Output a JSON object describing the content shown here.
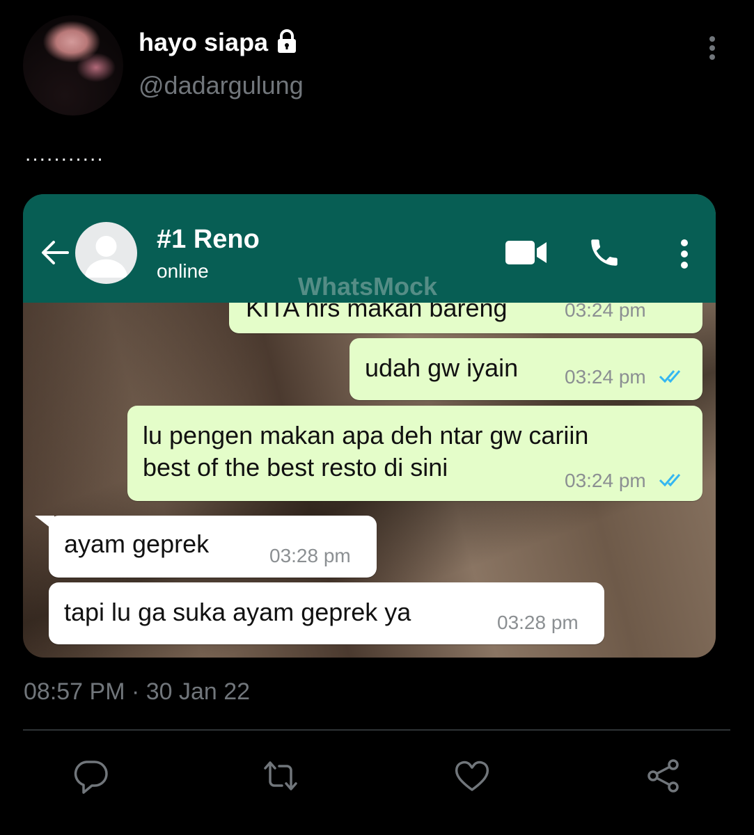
{
  "tweet": {
    "display_name": "hayo siapa",
    "handle": "@dadargulung",
    "text": "...........",
    "timestamp": "08:57 PM · 30 Jan 22"
  },
  "chat": {
    "contact_name": "#1 Reno",
    "status": "online",
    "watermark": "WhatsMock",
    "messages": [
      {
        "direction": "out",
        "text": "KITA hrs makan bareng",
        "time": "03:24 pm",
        "read": true
      },
      {
        "direction": "out",
        "text": "udah gw iyain",
        "time": "03:24 pm",
        "read": true
      },
      {
        "direction": "out",
        "line1": "lu pengen makan apa deh ntar gw cariin",
        "line2": "best of the best resto di sini",
        "time": "03:24 pm",
        "read": true
      },
      {
        "direction": "in",
        "text": "ayam geprek",
        "time": "03:28 pm"
      },
      {
        "direction": "in",
        "text": "tapi lu ga suka ayam geprek ya",
        "time": "03:28 pm"
      }
    ]
  },
  "icons": {
    "lock": "lock-icon",
    "more": "more-vertical-icon",
    "back": "arrow-left-icon",
    "video": "video-call-icon",
    "call": "phone-icon",
    "menu": "more-vertical-icon",
    "reply": "reply-icon",
    "retweet": "retweet-icon",
    "like": "heart-icon",
    "share": "share-icon"
  },
  "colors": {
    "background": "#000000",
    "secondary_text": "#71767b",
    "whatsapp_header": "#075e54",
    "outgoing_bubble": "#e4fdc9",
    "read_ticks": "#34b7f1"
  }
}
